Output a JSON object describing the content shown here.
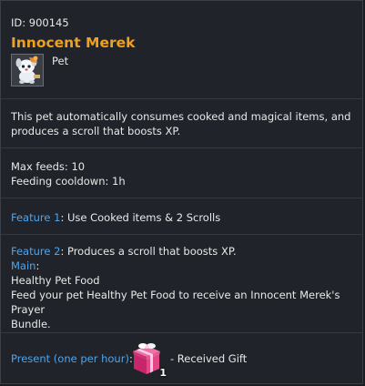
{
  "item": {
    "id_text": "ID: 900145",
    "name": "Innocent Merek",
    "type": "Pet"
  },
  "description": {
    "line1": "This pet automatically consumes cooked and magical items, and",
    "line2": "produces a scroll that boosts XP."
  },
  "stats": {
    "max_feeds": "Max feeds: 10",
    "cooldown": "Feeding cooldown: 1h"
  },
  "feature1": {
    "label": "Feature 1",
    "text": ": Use Cooked items & 2 Scrolls"
  },
  "feature2": {
    "label": "Feature 2",
    "text": ": Produces a scroll that boosts XP.",
    "main_label": "Main",
    "main_colon": ":",
    "food": "Healthy Pet Food",
    "feed_line1": "Feed your pet Healthy Pet Food to receive an Innocent Merek's Prayer",
    "feed_line2": "Bundle."
  },
  "present": {
    "label": "Present (one per hour)",
    "colon": ":",
    "count": "1",
    "suffix": "- Received Gift"
  },
  "colors": {
    "title": "#f0a020",
    "accent_blue": "#4ea4ec",
    "background": "#20242a",
    "text": "#e8e8e8"
  },
  "icons": {
    "pet": "pet-portrait-icon",
    "gift": "gift-box-icon"
  }
}
